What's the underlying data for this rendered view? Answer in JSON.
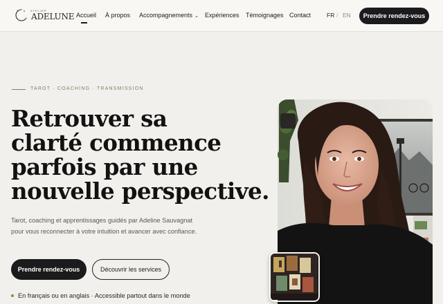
{
  "nav": {
    "logo_word": "ADELUNE",
    "logo_small": "ATELIER",
    "items": [
      {
        "label": "Accueil",
        "active": true
      },
      {
        "label": "À propos"
      },
      {
        "label": "Accompagnements",
        "has_dropdown": true
      },
      {
        "label": "Expériences"
      },
      {
        "label": "Témoignages"
      },
      {
        "label": "Contact"
      }
    ],
    "lang": {
      "fr": "FR",
      "sep": "/",
      "en": "EN",
      "active": "FR"
    },
    "cta": "Prendre rendez-vous"
  },
  "hero": {
    "eyebrow": "TAROT · COACHING · TRANSMISSION",
    "headline_lines": [
      "Retrouver sa",
      "clarté commence",
      "parfois par une",
      "nouvelle perspective."
    ],
    "subtitle": "Tarot, coaching et apprentissages guidés par Adeline Sauvagnat pour vous reconnecter à votre intuition et avancer avec confiance.",
    "primary_button": "Prendre rendez-vous",
    "secondary_button": "Découvrir les services",
    "note": "En français ou en anglais · Accessible partout dans le monde"
  },
  "colors": {
    "background": "#f1f0ed",
    "dark": "#1b1a1c",
    "accent": "#a07c54"
  }
}
